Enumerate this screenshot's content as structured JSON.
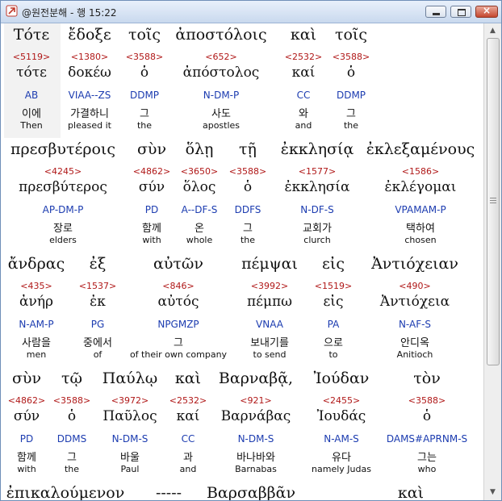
{
  "window": {
    "title": "@원전분해 - 행 15:22",
    "controls": {
      "minimize": "minimize",
      "maximize": "maximize",
      "close": "×"
    }
  },
  "rows": [
    {
      "words": [
        {
          "greek": "Τότε",
          "strong": "<5119>",
          "lemma": "τότε",
          "parse": "AB",
          "kor": "이에",
          "eng": "Then"
        },
        {
          "greek": "ἔδοξε",
          "strong": "<1380>",
          "lemma": "δοκέω",
          "parse": "VIAA--ZS",
          "kor": "가결하니",
          "eng": "pleased it"
        },
        {
          "greek": "τοῖς",
          "strong": "<3588>",
          "lemma": "ὁ",
          "parse": "DDMP",
          "kor": "그",
          "eng": "the"
        },
        {
          "greek": "ἀποστόλοις",
          "strong": "<652>",
          "lemma": "ἀπόστολος",
          "parse": "N-DM-P",
          "kor": "사도",
          "eng": "apostles"
        },
        {
          "greek": "καὶ",
          "strong": "<2532>",
          "lemma": "καί",
          "parse": "CC",
          "kor": "와",
          "eng": "and"
        },
        {
          "greek": "τοῖς",
          "strong": "<3588>",
          "lemma": "ὁ",
          "parse": "DDMP",
          "kor": "그",
          "eng": "the"
        }
      ]
    },
    {
      "words": [
        {
          "greek": "πρεσβυτέροις",
          "strong": "<4245>",
          "lemma": "πρεσβύτερος",
          "parse": "AP-DM-P",
          "kor": "장로",
          "eng": "elders"
        },
        {
          "greek": "σὺν",
          "strong": "<4862>",
          "lemma": "σύν",
          "parse": "PD",
          "kor": "함께",
          "eng": "with"
        },
        {
          "greek": "ὅλῃ",
          "strong": "<3650>",
          "lemma": "ὅλος",
          "parse": "A--DF-S",
          "kor": "온",
          "eng": "whole"
        },
        {
          "greek": "τῇ",
          "strong": "<3588>",
          "lemma": "ὁ",
          "parse": "DDFS",
          "kor": "그",
          "eng": "the"
        },
        {
          "greek": "ἐκκλησίᾳ",
          "strong": "<1577>",
          "lemma": "ἐκκλησία",
          "parse": "N-DF-S",
          "kor": "교회가",
          "eng": "clurch"
        },
        {
          "greek": "ἐκλεξαμένους",
          "strong": "<1586>",
          "lemma": "ἐκλέγομαι",
          "parse": "VPAMAM-P",
          "kor": "택하여",
          "eng": "chosen"
        }
      ]
    },
    {
      "words": [
        {
          "greek": "ἄνδρας",
          "strong": "<435>",
          "lemma": "ἀνήρ",
          "parse": "N-AM-P",
          "kor": "사람을",
          "eng": "men"
        },
        {
          "greek": "ἐξ",
          "strong": "<1537>",
          "lemma": "ἐκ",
          "parse": "PG",
          "kor": "중에서",
          "eng": "of"
        },
        {
          "greek": "αὐτῶν",
          "strong": "<846>",
          "lemma": "αὐτός",
          "parse": "NPGMZP",
          "kor": "그",
          "eng": "of their own company"
        },
        {
          "greek": "πέμψαι",
          "strong": "<3992>",
          "lemma": "πέμπω",
          "parse": "VNAA",
          "kor": "보내기를",
          "eng": "to send"
        },
        {
          "greek": "εἰς",
          "strong": "<1519>",
          "lemma": "εἰς",
          "parse": "PA",
          "kor": "으로",
          "eng": "to"
        },
        {
          "greek": "Ἀντιόχειαν",
          "strong": "<490>",
          "lemma": "Ἀντιόχεια",
          "parse": "N-AF-S",
          "kor": "안디옥",
          "eng": "Anitioch"
        }
      ]
    },
    {
      "words": [
        {
          "greek": "σὺν",
          "strong": "<4862>",
          "lemma": "σύν",
          "parse": "PD",
          "kor": "함께",
          "eng": "with"
        },
        {
          "greek": "τῷ",
          "strong": "<3588>",
          "lemma": "ὁ",
          "parse": "DDMS",
          "kor": "그",
          "eng": "the"
        },
        {
          "greek": "Παύλῳ",
          "strong": "<3972>",
          "lemma": "Παῦλος",
          "parse": "N-DM-S",
          "kor": "바울",
          "eng": "Paul"
        },
        {
          "greek": "καὶ",
          "strong": "<2532>",
          "lemma": "καί",
          "parse": "CC",
          "kor": "과",
          "eng": "and"
        },
        {
          "greek": "Βαρναβᾷ,",
          "strong": "<921>",
          "lemma": "Βαρνάβας",
          "parse": "N-DM-S",
          "kor": "바나바와",
          "eng": "Barnabas"
        },
        {
          "greek": "Ἰούδαν",
          "strong": "<2455>",
          "lemma": "Ἰουδάς",
          "parse": "N-AM-S",
          "kor": "유다",
          "eng": "namely Judas"
        },
        {
          "greek": "τὸν",
          "strong": "<3588>",
          "lemma": "ὁ",
          "parse": "DAMS#APRNM-S",
          "kor": "그는",
          "eng": "who"
        }
      ]
    },
    {
      "words": [
        {
          "greek": "ἐπικαλούμενον"
        },
        {
          "greek": "-----"
        },
        {
          "greek": "Βαρσαββᾶν"
        },
        {
          "greek": "καὶ"
        }
      ]
    }
  ]
}
